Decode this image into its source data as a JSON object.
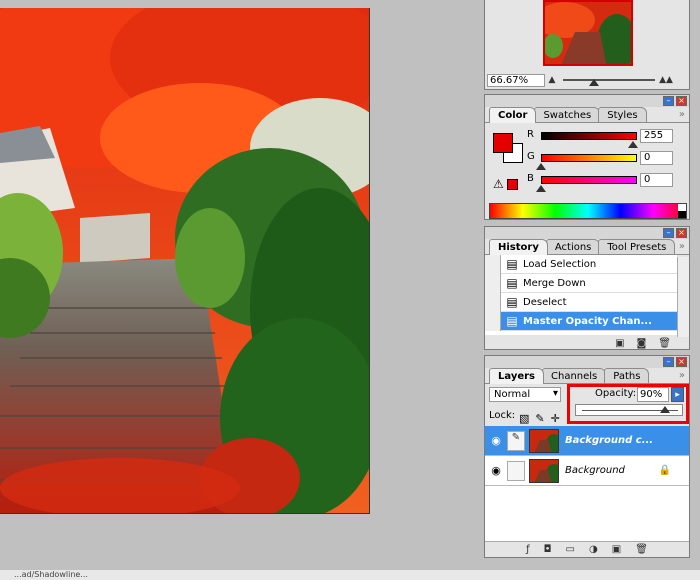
{
  "navigator": {
    "zoom": "66.67%",
    "zoom_slider": 0.33
  },
  "color": {
    "tabs": [
      "Color",
      "Swatches",
      "Styles"
    ],
    "menu_icon": "»",
    "channels": [
      {
        "label": "R",
        "value": "255",
        "gradient": "linear-gradient(to right,#000,#f00)",
        "marker": 0.95
      },
      {
        "label": "G",
        "value": "0",
        "gradient": "linear-gradient(to right,#f00,#ff0)",
        "marker": 0.0
      },
      {
        "label": "B",
        "value": "0",
        "gradient": "linear-gradient(to right,#f00,#f0f)",
        "marker": 0.0
      }
    ],
    "foreground": "#e40000",
    "background": "#ffffff"
  },
  "history": {
    "tabs": [
      "History",
      "Actions",
      "Tool Presets"
    ],
    "menu_icon": "»",
    "items": [
      {
        "label": "Load Selection",
        "selected": false
      },
      {
        "label": "Merge Down",
        "selected": false
      },
      {
        "label": "Deselect",
        "selected": false
      },
      {
        "label": "Master Opacity Chan...",
        "selected": true
      }
    ]
  },
  "layers": {
    "tabs": [
      "Layers",
      "Channels",
      "Paths"
    ],
    "menu_icon": "»",
    "blend_mode": "Normal",
    "opacity_label": "Opacity:",
    "opacity_value": "90%",
    "opacity_slider": 0.9,
    "lock_label": "Lock:",
    "items": [
      {
        "name": "Background c...",
        "selected": true,
        "locked": false
      },
      {
        "name": "Background",
        "selected": false,
        "locked": true
      }
    ]
  },
  "status": {
    "text": "...ad/Shadowline..."
  },
  "colors": {
    "accent": "#3a8fe8",
    "highlight": "#ee0000"
  }
}
